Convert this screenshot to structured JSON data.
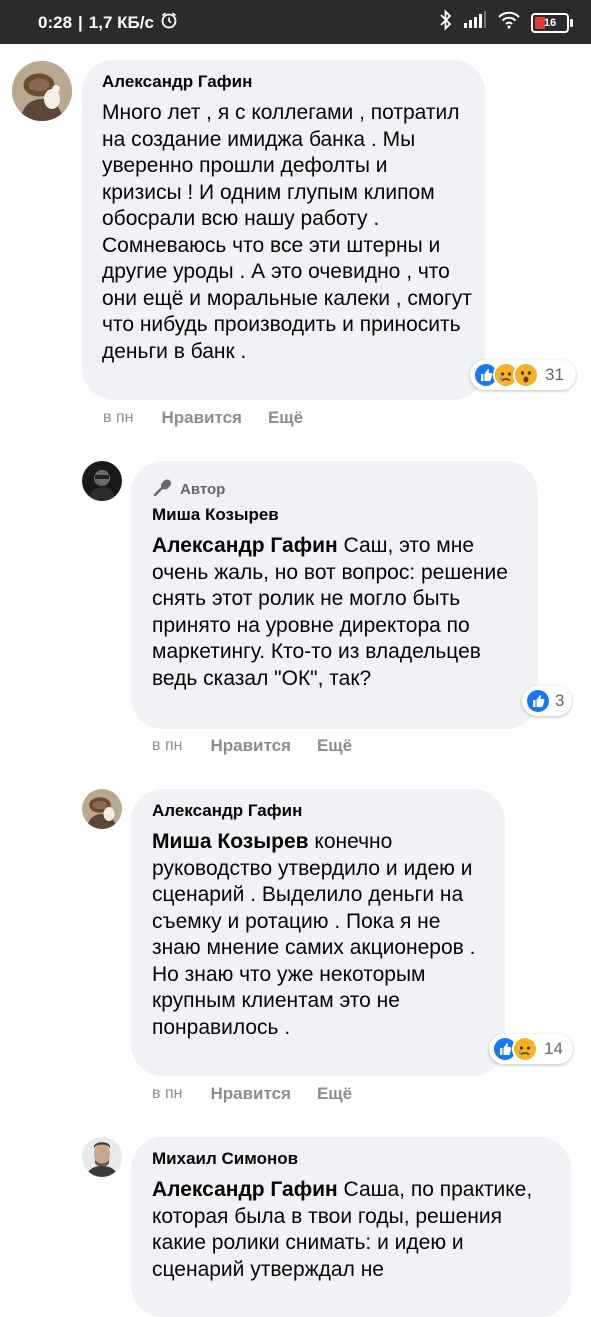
{
  "status_bar": {
    "time": "0:28",
    "speed": "1,7 КБ/с",
    "battery": "16"
  },
  "comments": [
    {
      "author": "Александр Гафин",
      "text": "Много лет , я с коллегами , потратил на создание имиджа банка . Мы уверенно прошли дефолты и кризисы ! И одним глупым клипом обосрали всю нашу работу . Сомневаюсь что все эти штерны и другие уроды . А это очевидно , что они ещё и моральные калеки , смогут что нибудь производить и приносить деньги в банк .",
      "reaction_count": "31",
      "time": "в пн",
      "like_label": "Нравится",
      "more_label": "Ещё"
    },
    {
      "badge": "Автор",
      "author": "Миша Козырев",
      "mention": "Александр Гафин",
      "text": " Саш, это мне очень жаль, но вот вопрос: решение снять этот ролик не могло быть принято на уровне директора по маркетингу. Кто-то из владельцев ведь сказал \"ОК\", так?",
      "reaction_count": "3",
      "time": "в пн",
      "like_label": "Нравится",
      "more_label": "Ещё"
    },
    {
      "author": "Александр Гафин",
      "mention": "Миша Козырев",
      "text": " конечно руководство утвердило и идею и сценарий . Выделило деньги на съемку и ротацию . Пока я не знаю мнение самих акционеров . Но знаю что уже некоторым крупным клиентам это не понравилось .",
      "reaction_count": "14",
      "time": "в пн",
      "like_label": "Нравится",
      "more_label": "Ещё"
    },
    {
      "author": "Михаил Симонов",
      "mention": "Александр Гафин",
      "text": " Саша, по практике, которая была в твои годы, решения какие ролики снимать: и идею и сценарий утверждал не"
    }
  ],
  "colors": {
    "like": "#1877f2",
    "bubble": "#f0f2f5",
    "meta": "#8a8d91"
  }
}
